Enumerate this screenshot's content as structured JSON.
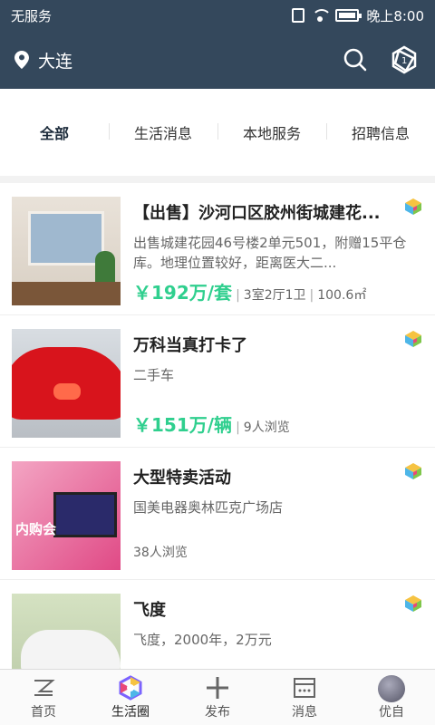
{
  "status_bar": {
    "carrier": "无服务",
    "time": "晚上8:00"
  },
  "header": {
    "city": "大连"
  },
  "tabs": [
    {
      "label": "全部"
    },
    {
      "label": "生活消息"
    },
    {
      "label": "本地服务"
    },
    {
      "label": "招聘信息"
    }
  ],
  "feed": [
    {
      "title": "【出售】沙河口区胶州街城建花...",
      "desc": "出售城建花园46号楼2单元501，附赠15平仓库。地理位置较好，距离医大二...",
      "price": "￥192万/套",
      "meta1": "3室2厅1卫",
      "meta2": "100.6㎡"
    },
    {
      "title": "万科当真打卡了",
      "desc": "二手车",
      "price": "￥151万/辆",
      "meta1": "9人浏览"
    },
    {
      "title": "大型特卖活动",
      "desc": "国美电器奥林匹克广场店",
      "views": "38人浏览",
      "image_text": "内购会"
    },
    {
      "title": "飞度",
      "desc": "飞度，2000年，2万元"
    }
  ],
  "bottom_nav": [
    {
      "label": "首页"
    },
    {
      "label": "生活圈"
    },
    {
      "label": "发布"
    },
    {
      "label": "消息"
    },
    {
      "label": "优自"
    }
  ],
  "colors": {
    "header": "#34485c",
    "price": "#2fcf8e"
  }
}
